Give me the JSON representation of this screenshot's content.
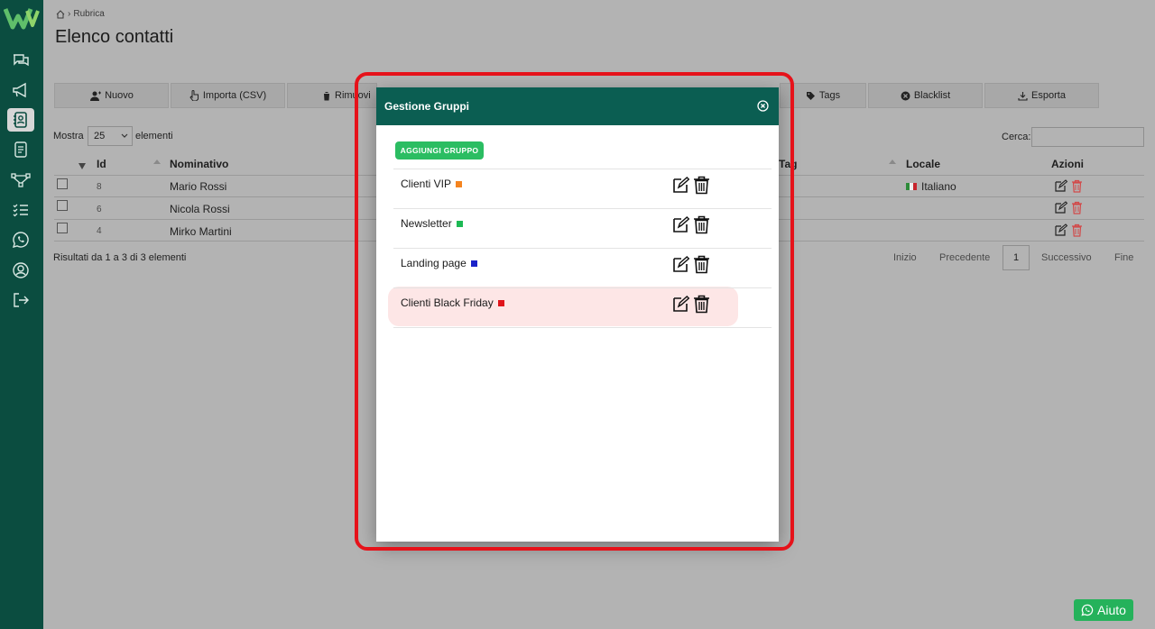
{
  "breadcrumb": {
    "label": "Rubrica"
  },
  "page": {
    "title": "Elenco contatti"
  },
  "toolbar": {
    "nuovo": "Nuovo",
    "importa": "Importa (CSV)",
    "rimuovi": "Rimuovi",
    "tags": "Tags",
    "blacklist": "Blacklist",
    "esporta": "Esporta"
  },
  "table_controls": {
    "show_prefix": "Mostra",
    "show_value": "25",
    "show_suffix": "elementi",
    "search_label": "Cerca:"
  },
  "table": {
    "headers": {
      "id": "Id",
      "nominativo": "Nominativo",
      "tag": "Tag",
      "locale": "Locale",
      "azioni": "Azioni"
    },
    "rows": [
      {
        "id": "8",
        "name": "Mario Rossi",
        "locale": "Italiano"
      },
      {
        "id": "6",
        "name": "Nicola Rossi",
        "locale": ""
      },
      {
        "id": "4",
        "name": "Mirko Martini",
        "locale": ""
      }
    ],
    "summary": "Risultati da 1 a 3 di 3 elementi"
  },
  "pagination": {
    "first": "Inizio",
    "prev": "Precedente",
    "current": "1",
    "next": "Successivo",
    "last": "Fine"
  },
  "help": {
    "label": "Aiuto"
  },
  "modal": {
    "title": "Gestione Gruppi",
    "add_button": "AGGIUNGI GRUPPO",
    "groups": [
      {
        "name": "Clienti VIP",
        "color": "#f5841f"
      },
      {
        "name": "Newsletter",
        "color": "#1db954"
      },
      {
        "name": "Landing page",
        "color": "#1a22c9"
      },
      {
        "name": "Clienti Black Friday",
        "color": "#e0141b"
      }
    ]
  },
  "colors": {
    "sidebar": "#0b4d40",
    "modal_header": "#0b5e52",
    "accent_green": "#2bbd62",
    "highlight_frame": "#e6121a"
  }
}
